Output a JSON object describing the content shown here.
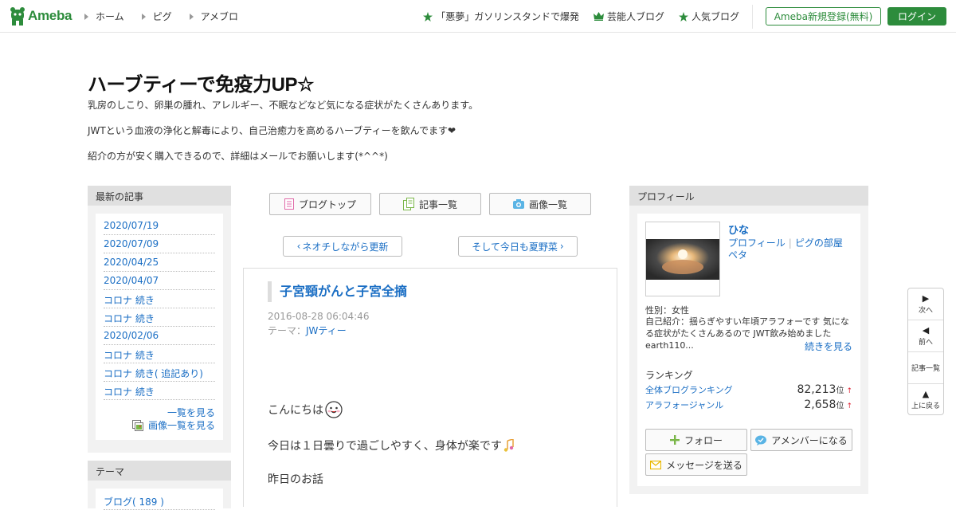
{
  "header": {
    "logo_text": "Ameba",
    "global_nav": [
      "ホーム",
      "ピグ",
      "アメブロ"
    ],
    "hot_links": [
      {
        "icon": "star-icon",
        "label": "「悪夢」ガソリンスタンドで爆発"
      },
      {
        "icon": "crown-icon",
        "label": "芸能人ブログ"
      },
      {
        "icon": "star-icon",
        "label": "人気ブログ"
      }
    ],
    "register_label": "Ameba新規登録(無料)",
    "login_label": "ログイン",
    "accent_color": "#2d8c3c"
  },
  "blog": {
    "title": "ハーブティーで免疫力UP☆",
    "description": [
      "乳房のしこり、卵巣の腫れ、アレルギー、不眠などなど気になる症状がたくさんあります。",
      "JWTという血液の浄化と解毒により、自己治癒力を高めるハーブティーを飲んでます❤",
      "紹介の方が安く購入できるので、詳細はメールでお願いします(*^^*)"
    ]
  },
  "sidebar_left": {
    "recent_title": "最新の記事",
    "recent_entries": [
      "2020/07/19",
      "2020/07/09",
      "2020/04/25",
      "2020/04/07",
      "コロナ 続き",
      "コロナ 続き",
      "2020/02/06",
      "コロナ 続き",
      "コロナ 続き( 追記あり)",
      "コロナ 続き"
    ],
    "see_all_label": "一覧を見る",
    "see_images_label": "画像一覧を見る",
    "theme_title": "テーマ",
    "theme_first": "ブログ( 189 )"
  },
  "blog_nav": {
    "top_label": "ブログトップ",
    "entries_label": "記事一覧",
    "images_label": "画像一覧",
    "prev_label": "ネオチしながら更新",
    "next_label": "そして今日も夏野菜"
  },
  "article": {
    "title": "子宮頸がんと子宮全摘",
    "date": "2016-08-28 06:04:46",
    "theme_prefix": "テーマ：",
    "theme": "JWティー",
    "paragraphs": [
      "こんにちは",
      "今日は１日曇りで過ごしやすく、身体が楽です",
      "昨日のお話"
    ]
  },
  "profile": {
    "title": "プロフィール",
    "name": "ひな",
    "link_profile": "プロフィール",
    "link_pig": "ピグの部屋",
    "link_peta": "ペタ",
    "gender": "性別：女性",
    "intro": "自己紹介：揺らぎやすい年頃アラフォーです 気になる症状がたくさんあるので JWT飲み始めました earth110...",
    "read_more": "続きを見る",
    "ranking_title": "ランキング",
    "rankings": [
      {
        "label": "全体ブログランキング",
        "value": "82,213",
        "unit": "位",
        "trend": "↑"
      },
      {
        "label": "アラフォージャンル",
        "value": "2,658",
        "unit": "位",
        "trend": "↑"
      }
    ],
    "follow_label": "フォロー",
    "amember_label": "アメンバーになる",
    "message_label": "メッセージを送る"
  },
  "float_nav": [
    "次へ",
    "前へ",
    "記事一覧",
    "上に戻る"
  ]
}
